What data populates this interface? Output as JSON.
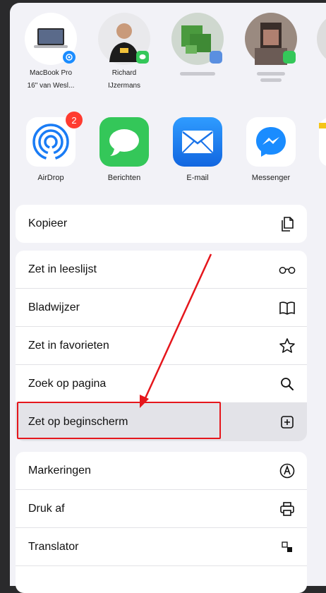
{
  "contacts": [
    {
      "name_line1": "MacBook Pro",
      "name_line2": "16\" van Wesl..."
    },
    {
      "name_line1": "Richard",
      "name_line2": "IJzermans"
    }
  ],
  "apps": [
    {
      "label": "AirDrop",
      "badge": "2"
    },
    {
      "label": "Berichten"
    },
    {
      "label": "E-mail"
    },
    {
      "label": "Messenger"
    }
  ],
  "group1": [
    {
      "label": "Kopieer",
      "icon": "copy-icon"
    }
  ],
  "group2": [
    {
      "label": "Zet in leeslijst",
      "icon": "glasses-icon"
    },
    {
      "label": "Bladwijzer",
      "icon": "book-icon"
    },
    {
      "label": "Zet in favorieten",
      "icon": "star-icon"
    },
    {
      "label": "Zoek op pagina",
      "icon": "search-icon"
    },
    {
      "label": "Zet op beginscherm",
      "icon": "add-square-icon"
    }
  ],
  "group3": [
    {
      "label": "Markeringen",
      "icon": "markup-icon"
    },
    {
      "label": "Druk af",
      "icon": "printer-icon"
    },
    {
      "label": "Translator",
      "icon": "translate-icon"
    }
  ],
  "colors": {
    "highlight_border": "#e5161c",
    "airdrop_badge": "#ff3b30"
  }
}
